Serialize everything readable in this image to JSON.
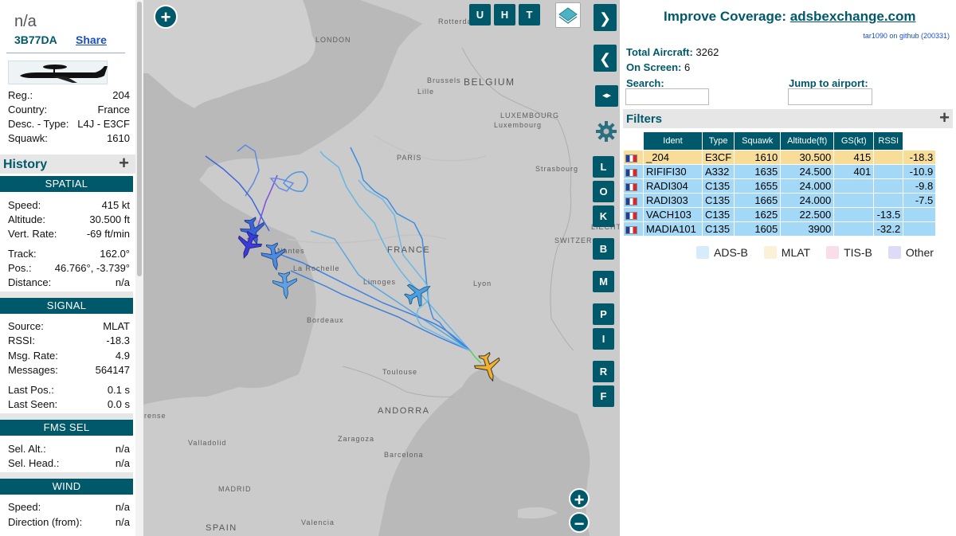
{
  "info": {
    "callsign": "n/a",
    "hex": "3B77DA",
    "share_label": "Share",
    "registration": {
      "label": "Reg.:",
      "value": "204"
    },
    "country": {
      "label": "Country:",
      "value": "France"
    },
    "desc_type": {
      "label": "Desc. - Type:",
      "value": "L4J - E3CF"
    },
    "squawk": {
      "label": "Squawk:",
      "value": "1610"
    },
    "history_title": "History",
    "sections": {
      "spatial": "SPATIAL",
      "signal": "SIGNAL",
      "fms_sel": "FMS SEL",
      "wind": "WIND"
    },
    "spatial": {
      "speed": {
        "label": "Speed:",
        "value": "415 kt"
      },
      "altitude": {
        "label": "Altitude:",
        "value": "30.500 ft"
      },
      "vert_rate": {
        "label": "Vert. Rate:",
        "value": "-69 ft/min"
      },
      "track": {
        "label": "Track:",
        "value": "162.0°"
      },
      "pos": {
        "label": "Pos.:",
        "value": "46.766°, -3.739°"
      },
      "distance": {
        "label": "Distance:",
        "value": "n/a"
      }
    },
    "signal": {
      "source": {
        "label": "Source:",
        "value": "MLAT"
      },
      "rssi": {
        "label": "RSSI:",
        "value": "-18.3"
      },
      "msg_rate": {
        "label": "Msg. Rate:",
        "value": "4.9"
      },
      "messages": {
        "label": "Messages:",
        "value": "564147"
      },
      "last_pos": {
        "label": "Last Pos.:",
        "value": "0.1 s"
      },
      "last_seen": {
        "label": "Last Seen:",
        "value": "0.0 s"
      }
    },
    "fms": {
      "sel_alt": {
        "label": "Sel. Alt.:",
        "value": "n/a"
      },
      "sel_head": {
        "label": "Sel. Head.:",
        "value": "n/a"
      }
    },
    "wind": {
      "speed": {
        "label": "Speed:",
        "value": "n/a"
      },
      "direction": {
        "label": "Direction (from):",
        "value": "n/a"
      }
    }
  },
  "map": {
    "labels": {
      "london": "LONDON",
      "rotterdam": "Rotterdam",
      "brussels": "Brussels",
      "belgium": "BELGIUM",
      "lille": "Lille",
      "luxembourg_country": "LUXEMBOURG",
      "luxembourg_city": "Luxembourg",
      "paris": "PARIS",
      "strasbourg": "Strasbourg",
      "france": "FRANCE",
      "switzerland": "SWITZER",
      "liecht": "LIECHT",
      "nantes": "Nantes",
      "la_rochelle": "La Rochelle",
      "limoges": "Limoges",
      "lyon": "Lyon",
      "bordeaux": "Bordeaux",
      "toulouse": "Toulouse",
      "andorra": "ANDORRA",
      "valladolid": "Valladolid",
      "zaragoza": "Zaragoza",
      "barcelona": "Barcelona",
      "madrid": "MADRID",
      "spain": "SPAIN",
      "valencia": "Valencia",
      "burense": "urense"
    },
    "buttons": {
      "u": "U",
      "h": "H",
      "t": "T",
      "next": "❯",
      "prev": "❮",
      "expand": "◂▸",
      "l": "L",
      "o": "O",
      "k": "K",
      "b": "B",
      "m": "M",
      "p": "P",
      "i": "I",
      "r": "R",
      "f": "F",
      "zoom_in": "+",
      "zoom_out": "−",
      "add": "+"
    }
  },
  "right": {
    "coverage_prefix": "Improve Coverage: ",
    "coverage_link": "adsbexchange.com",
    "github": "tar1090 on github (200331)",
    "total_label": "Total Aircraft:",
    "total_value": "3262",
    "onscreen_label": "On Screen:",
    "onscreen_value": "6",
    "search_label": "Search:",
    "search_value": "",
    "jump_label": "Jump to airport:",
    "jump_value": "",
    "filters_title": "Filters",
    "table": {
      "headers": [
        "Ident",
        "Type",
        "Squawk",
        "Altitude(ft)",
        "GS(kt)",
        "RSSI"
      ],
      "rows": [
        {
          "ident": "_204",
          "type": "E3CF",
          "squawk": "1610",
          "alt": "30.500",
          "gs": "415",
          "rssi": "-18.3",
          "source": "mlat"
        },
        {
          "ident": "RIFIFI30",
          "type": "A332",
          "squawk": "1635",
          "alt": "24.500",
          "gs": "401",
          "rssi": "-10.9",
          "source": "ads"
        },
        {
          "ident": "RADI304",
          "type": "C135",
          "squawk": "1655",
          "alt": "24.000",
          "gs": "",
          "rssi": "-9.8",
          "source": "ads"
        },
        {
          "ident": "RADI303",
          "type": "C135",
          "squawk": "1665",
          "alt": "24.000",
          "gs": "",
          "rssi": "-7.5",
          "source": "ads"
        },
        {
          "ident": "VACH103",
          "type": "C135",
          "squawk": "1625",
          "alt": "22.500",
          "gs": "",
          "rssi": "-13.5",
          "source": "ads"
        },
        {
          "ident": "MADIA101",
          "type": "C135",
          "squawk": "1605",
          "alt": "3900",
          "gs": "",
          "rssi": "-32.2",
          "source": "ads"
        }
      ]
    },
    "legend": [
      {
        "label": "ADS-B",
        "color": "#d7ecfa"
      },
      {
        "label": "MLAT",
        "color": "#fbf1d8"
      },
      {
        "label": "TIS-B",
        "color": "#fbdde9"
      },
      {
        "label": "Other",
        "color": "#dcdcf7"
      }
    ]
  }
}
